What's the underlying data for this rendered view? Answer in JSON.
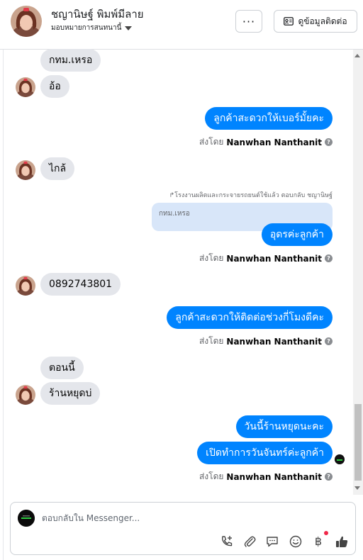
{
  "header": {
    "contact_name": "ชญานิษฐ์ พิมพ์มีลาย",
    "assign_label": "มอบหมายการสนทนานี้",
    "more_label": "···",
    "contact_info_label": "ดูข้อมูลติดต่อ"
  },
  "messages": {
    "m1": "กทม.เหรอ",
    "m2": "อ้อ",
    "m3": "ลูกค้าสะดวกให้เบอร์มั้ยคะ",
    "m4": "ไกล้",
    "m5_reply_note": "โรงงานผลิตและกระจายรถยนต์ใช้แล้ว ตอบกลับ ชญานิษฐ์",
    "m5_quote": "กทม.เหรอ",
    "m5": "อุดรค่ะลูกค้า",
    "m6": "0892743801",
    "m7": "ลูกค้าสะดวกให้ติดต่อช่วงกี่โมงดีคะ",
    "m8": "ตอนนี้",
    "m9": "ร้านหยุดบ่",
    "m10": "วันนี้ร้านหยุดนะคะ",
    "m11": "เปิดทำการวันจันทร์ค่ะลูกค้า"
  },
  "sent_by": {
    "prefix": "ส่งโดย",
    "name": "Nanwhan Nanthanit"
  },
  "composer": {
    "placeholder": "ตอบกลับใน Messenger...",
    "value": ""
  },
  "colors": {
    "outgoing": "#0084ff",
    "incoming": "#e4e6eb",
    "quote": "#d8e6f9"
  },
  "icons": [
    "ellipsis-icon",
    "contact-card-icon",
    "chevron-down-icon",
    "help-icon",
    "phone-add-icon",
    "attachment-icon",
    "saved-reply-icon",
    "emoji-icon",
    "baht-icon",
    "like-icon"
  ]
}
